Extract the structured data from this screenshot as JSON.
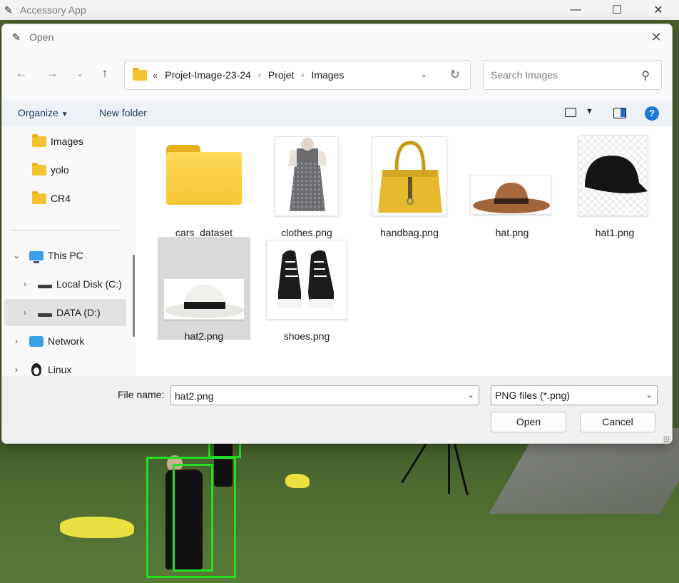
{
  "app": {
    "title": "Accessory App"
  },
  "dialog": {
    "title": "Open",
    "address": {
      "overflow_label": "«",
      "crumbs": [
        "Projet-Image-23-24",
        "Projet",
        "Images"
      ]
    },
    "search": {
      "placeholder": "Search Images"
    },
    "toolbar": {
      "organize_label": "Organize",
      "new_folder_label": "New folder",
      "help_label": "?"
    },
    "nav": {
      "items": [
        {
          "label": "Images",
          "icon": "folder-icon"
        },
        {
          "label": "yolo",
          "icon": "folder-icon"
        },
        {
          "label": "CR4",
          "icon": "folder-icon"
        },
        {
          "label": "This PC",
          "icon": "pc-icon",
          "expanded": true
        },
        {
          "label": "Local Disk (C:)",
          "icon": "disk-icon"
        },
        {
          "label": "DATA (D:)",
          "icon": "disk-icon",
          "selected": true
        },
        {
          "label": "Network",
          "icon": "network-icon"
        },
        {
          "label": "Linux",
          "icon": "linux-icon"
        }
      ]
    },
    "files": [
      {
        "name": "cars_dataset",
        "kind": "folder"
      },
      {
        "name": "clothes.png",
        "kind": "image"
      },
      {
        "name": "handbag.png",
        "kind": "image"
      },
      {
        "name": "hat.png",
        "kind": "image"
      },
      {
        "name": "hat1.png",
        "kind": "image"
      },
      {
        "name": "hat2.png",
        "kind": "image",
        "selected": true
      },
      {
        "name": "shoes.png",
        "kind": "image"
      }
    ],
    "footer": {
      "file_name_label": "File name:",
      "file_name_value": "hat2.png",
      "file_type_value": "PNG files (*.png)",
      "open_label": "Open",
      "cancel_label": "Cancel"
    }
  },
  "colors": {
    "accent": "#1a78d6",
    "bbox": "#22e022",
    "folder": "#f4c430"
  }
}
